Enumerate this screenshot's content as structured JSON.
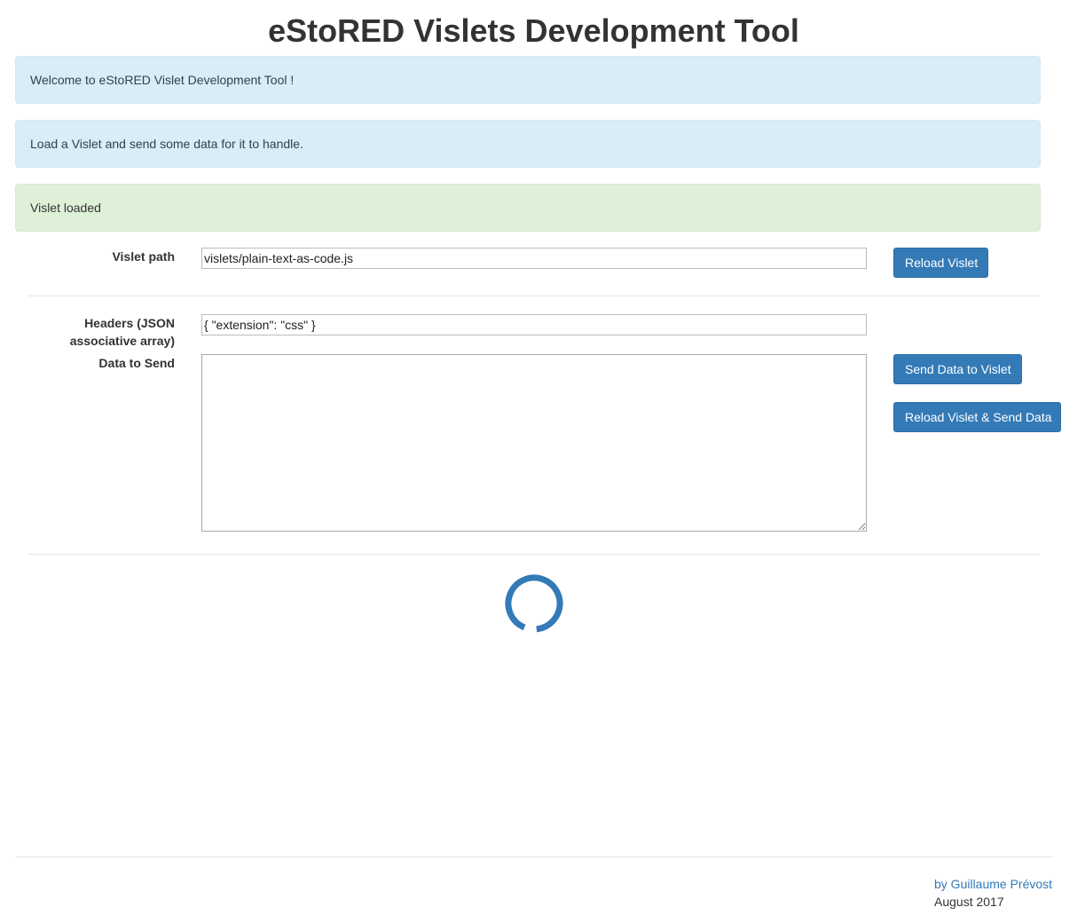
{
  "header": {
    "title": "eStoRED Vislets Development Tool"
  },
  "alerts": {
    "welcome": "Welcome to eStoRED Vislet Development Tool !",
    "instructions": "Load a Vislet and send some data for it to handle.",
    "status": "Vislet loaded"
  },
  "form": {
    "vislet_path_label": "Vislet path",
    "vislet_path_value": "vislets/plain-text-as-code.js",
    "reload_button": "Reload Vislet",
    "headers_label_line1": "Headers (JSON",
    "headers_label_line2": "associative array)",
    "headers_value": "{ \"extension\": \"css\" }",
    "data_label": "Data to Send",
    "data_value": "",
    "send_button": "Send Data to Vislet",
    "reload_send_button": "Reload Vislet & Send Data"
  },
  "spinner": {
    "icon": "loading-spinner-icon",
    "color": "#337ab7"
  },
  "footer": {
    "author": "by Guillaume Prévost",
    "date": "August 2017"
  },
  "colors": {
    "primary": "#337ab7",
    "info_bg": "#d9edf7",
    "success_bg": "#dff0d8"
  }
}
